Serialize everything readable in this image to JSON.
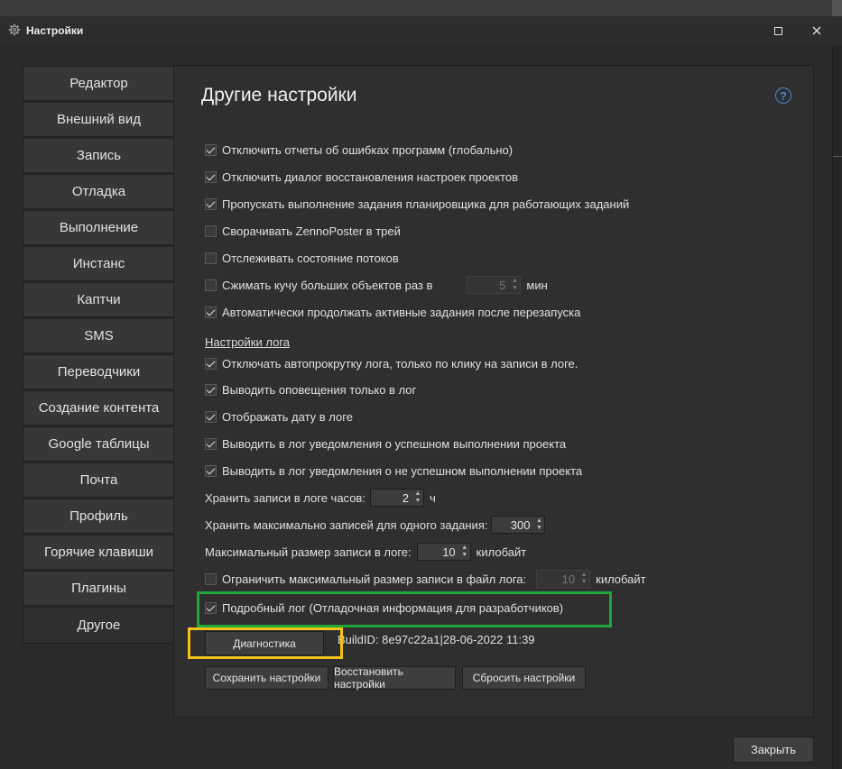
{
  "window": {
    "title": "Настройки"
  },
  "tabs": [
    "Редактор",
    "Внешний вид",
    "Запись",
    "Отладка",
    "Выполнение",
    "Инстанс",
    "Каптчи",
    "SMS",
    "Переводчики",
    "Создание контента",
    "Google таблицы",
    "Почта",
    "Профиль",
    "Горячие клавиши",
    "Плагины",
    "Другое"
  ],
  "active_tab": "Другое",
  "heading": "Другие настройки",
  "help_label": "?",
  "general": [
    {
      "label": "Отключить отчеты об ошибках программ (глобально)",
      "checked": true
    },
    {
      "label": "Отключить диалог восстановления настроек проектов",
      "checked": true
    },
    {
      "label": "Пропускать выполнение задания планировщика для работающих заданий",
      "checked": true
    },
    {
      "label": "Сворачивать ZennoPoster в трей",
      "checked": false
    },
    {
      "label": "Отслеживать состояние потоков",
      "checked": false
    }
  ],
  "compress": {
    "label": "Сжимать кучу больших объектов раз в",
    "checked": false,
    "value": "5",
    "unit": "мин"
  },
  "autocontinue": {
    "label": "Автоматически продолжать активные задания после перезапуска",
    "checked": true
  },
  "log_section_title": "Настройки лога",
  "log": [
    {
      "label": "Отключать автопрокрутку лога, только по клику на записи в логе.",
      "checked": true
    },
    {
      "label": "Выводить оповещения только в лог",
      "checked": true
    },
    {
      "label": "Отображать дату в логе",
      "checked": true
    },
    {
      "label": "Выводить в лог уведомления о успешном выполнении проекта",
      "checked": true
    },
    {
      "label": "Выводить в лог уведомления о не успешном выполнении проекта",
      "checked": true
    }
  ],
  "keep_hours": {
    "label": "Хранить записи в логе часов:",
    "value": "2",
    "unit": "ч"
  },
  "max_records": {
    "label": "Хранить максимально записей для одного задания:",
    "value": "300"
  },
  "max_size": {
    "label": "Максимальный размер записи в логе:",
    "value": "10",
    "unit": "килобайт"
  },
  "limit_file": {
    "label": "Ограничить максимальный размер записи в файл лога:",
    "checked": false,
    "value": "10",
    "unit": "килобайт"
  },
  "verbose": {
    "label": "Подробный лог (Отладочная информация для разработчиков)",
    "checked": true
  },
  "diagnostics_label": "Диагностика",
  "build_id": "BuildID: 8e97c22a1|28-06-2022 11:39",
  "buttons": {
    "save": "Сохранить настройки",
    "restore": "Восстановить настройки",
    "reset": "Сбросить настройки",
    "close": "Закрыть"
  },
  "colors": {
    "highlight_green": "#1fa83a",
    "highlight_yellow": "#f4c21a",
    "help_blue": "#4a8ad8"
  }
}
